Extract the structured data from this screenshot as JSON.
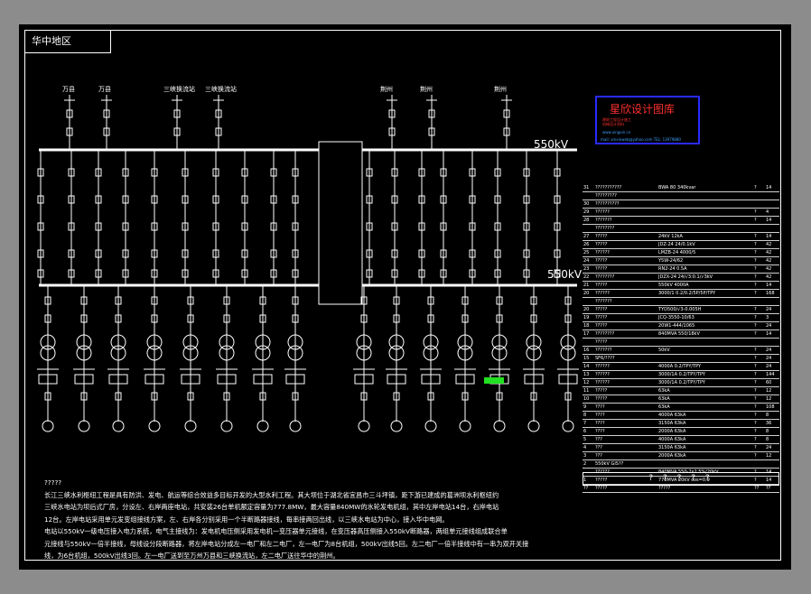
{
  "region_label": "华中地区",
  "bus_labels": {
    "upper": "550kV",
    "lower": "550kV"
  },
  "source_labels": [
    "万县",
    "万县",
    "三峡换流站",
    "三峡换流站",
    "荆州",
    "荆州",
    "荆州"
  ],
  "stamp": {
    "title": "星欣设计图库",
    "sub_lines": [
      "建筑工程设计施工",
      "机械设计资料"
    ],
    "url": "www.xingxin.cn",
    "mail": "mail: xinxinweb@yahoo.com  TEL: 13979880"
  },
  "table": {
    "footer": "? ? ? ? ?",
    "rows": [
      {
        "no": "31",
        "name": "???????????",
        "spec": "BWA  80  340kvar",
        "unit": "?",
        "qty": "14"
      },
      {
        "no": "",
        "name": "?????????",
        "spec": "",
        "unit": "",
        "qty": ""
      },
      {
        "no": "30",
        "name": "??????????",
        "spec": "",
        "unit": "",
        "qty": ""
      },
      {
        "no": "29",
        "name": "??????",
        "spec": "",
        "unit": "?",
        "qty": "4"
      },
      {
        "no": "28",
        "name": "???????",
        "spec": "",
        "unit": "?",
        "qty": "14"
      },
      {
        "no": "",
        "name": "????????",
        "spec": "",
        "unit": "",
        "qty": ""
      },
      {
        "no": "27",
        "name": "?????",
        "spec": "24kV  12kA",
        "unit": "?",
        "qty": "14"
      },
      {
        "no": "26",
        "name": "?????",
        "spec": "JDZ-24  24/0.1kV",
        "unit": "?",
        "qty": "42"
      },
      {
        "no": "25",
        "name": "??????",
        "spec": "LMZB-24  4000/5",
        "unit": "?",
        "qty": "42"
      },
      {
        "no": "24",
        "name": "?????",
        "spec": "Y5W-24/62",
        "unit": "?",
        "qty": "42"
      },
      {
        "no": "23",
        "name": "?????",
        "spec": "RN2-24  0.5A",
        "unit": "?",
        "qty": "42"
      },
      {
        "no": "22",
        "name": "????????",
        "spec": "JDZX-24  24/√3:0.1/√3kV",
        "unit": "?",
        "qty": "42"
      },
      {
        "no": "21",
        "name": "?????",
        "spec": "550kV  4000A",
        "unit": "?",
        "qty": "14"
      },
      {
        "no": "20",
        "name": "??????",
        "spec": "3000/1  0.2/0.2/5P/5P/TPY",
        "unit": "?",
        "qty": "168"
      },
      {
        "no": "",
        "name": "???????",
        "spec": "",
        "unit": "",
        "qty": ""
      },
      {
        "no": "20",
        "name": "?????",
        "spec": "TYD500/√3-0.005H",
        "unit": "?",
        "qty": "24"
      },
      {
        "no": "19",
        "name": "?????",
        "spec": "JCQ-3550-10/63",
        "unit": "?",
        "qty": "3"
      },
      {
        "no": "18",
        "name": "?????",
        "spec": "20W1-444/1065",
        "unit": "?",
        "qty": "24"
      },
      {
        "no": "17",
        "name": "????????",
        "spec": "840MVA  550/18kV",
        "unit": "?",
        "qty": "14"
      },
      {
        "no": "",
        "name": "?????",
        "spec": "",
        "unit": "",
        "qty": ""
      },
      {
        "no": "16",
        "name": "???????",
        "spec": "50kV",
        "unit": "?",
        "qty": "24"
      },
      {
        "no": "15",
        "name": "SF6/????",
        "spec": "",
        "unit": "?",
        "qty": "24"
      },
      {
        "no": "14",
        "name": "??????",
        "spec": "4000A  0.2/TPY/TPY",
        "unit": "?",
        "qty": "24"
      },
      {
        "no": "13",
        "name": "??????",
        "spec": "3000/1A  0.2/TPY/TPY",
        "unit": "?",
        "qty": "144"
      },
      {
        "no": "12",
        "name": "??????",
        "spec": "3000/1A  0.2/TPY/TPY",
        "unit": "?",
        "qty": "60"
      },
      {
        "no": "11",
        "name": "?????",
        "spec": "63kA",
        "unit": "?",
        "qty": "12"
      },
      {
        "no": "10",
        "name": "?????",
        "spec": "63kA",
        "unit": "?",
        "qty": "12"
      },
      {
        "no": "9",
        "name": "????",
        "spec": "63kA",
        "unit": "?",
        "qty": "108"
      },
      {
        "no": "8",
        "name": "????",
        "spec": "4000A  63kA",
        "unit": "?",
        "qty": "8"
      },
      {
        "no": "7",
        "name": "????",
        "spec": "3150A  63kA",
        "unit": "?",
        "qty": "36"
      },
      {
        "no": "6",
        "name": "????",
        "spec": "2000A  63kA",
        "unit": "?",
        "qty": "8"
      },
      {
        "no": "5",
        "name": "???",
        "spec": "4000A  63kA",
        "unit": "?",
        "qty": "8"
      },
      {
        "no": "4",
        "name": "???",
        "spec": "3150A  63kA",
        "unit": "?",
        "qty": "24"
      },
      {
        "no": "3",
        "name": "???",
        "spec": "2000A  63kA",
        "unit": "?",
        "qty": "12"
      },
      {
        "no": "2",
        "name": "550kV GIS??",
        "spec": "",
        "unit": "",
        "qty": ""
      },
      {
        "no": "",
        "name": "??????",
        "spec": "840MVA  550-2x2.5%/20kV",
        "unit": "?",
        "qty": "14"
      },
      {
        "no": "1",
        "name": "?????",
        "spec": "778MVA  20kV  cos=0.9",
        "unit": "?",
        "qty": "14"
      },
      {
        "no": "??",
        "name": "?????",
        "spec": "?????",
        "unit": "??",
        "qty": "??"
      }
    ]
  },
  "notes": [
    "?????",
    "长江三峡水利枢纽工程是具有防洪、发电、航运等综合效益多目标开发的大型水利工程。其大坝位于湖北省宜昌市三斗坪镇，距下游已建成的葛洲坝水利枢纽约",
    "三峡水电站为坝后式厂房，分设左、右岸两座电站，共安装26台单机额定容量为777.8MW，最大容量840MW的水轮发电机组，其中左岸电站14台，右岸电站",
    "12台。左岸电站采用单元发变组接线方案，左、右岸各分别采用一个半断路器接线，每串接两回出线，以三峡水电站为中心，接入华中电网。",
    "电站以550kV一级电压接入电力系统，电气主接线为：发电机电压侧采用发电机一变压器单元接线，在变压器高压侧接入550kV断路器，两组单元接线组成联合单",
    "元接线与550kV一倍半接线，母线设分段断路器，将左岸电站分成左一电厂和左二电厂，左一电厂为8台机组，500kV出线5回。左二电厂一倍半接线中有一串为双开关接",
    "线，为6台机组，500kV出线3回。左一电厂送到至万州万县和三峡换流站，左二电厂送往华中的荆州。"
  ]
}
